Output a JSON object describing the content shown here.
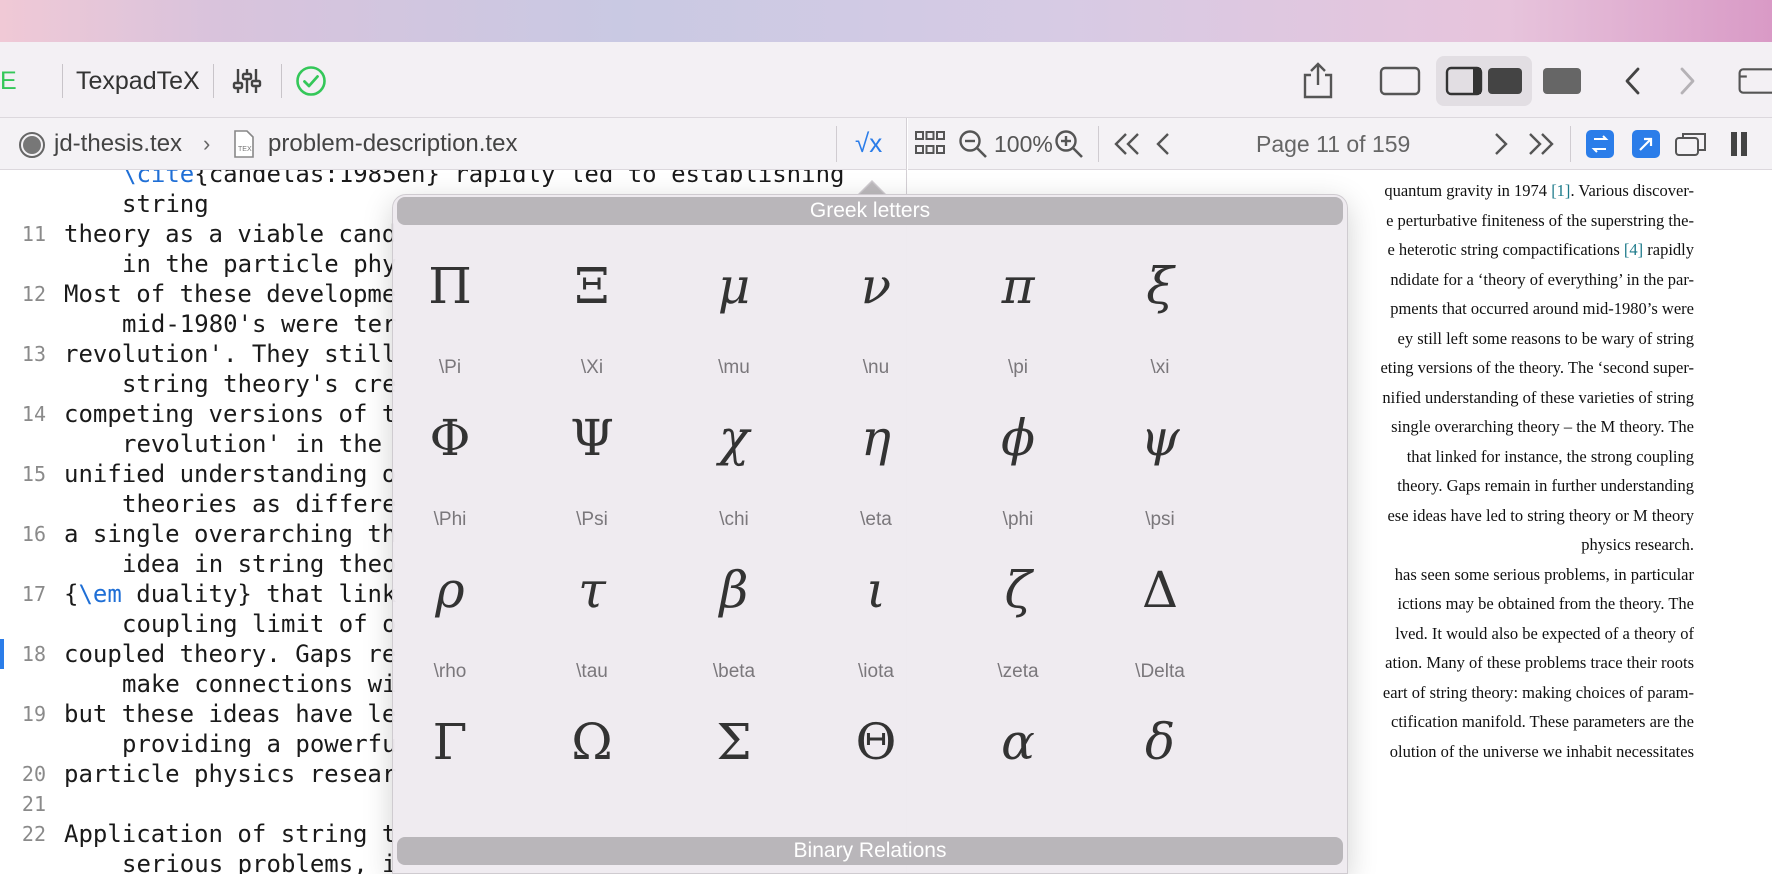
{
  "toolbar": {
    "left_fragment": "E",
    "typesetter": "TexpadTeX"
  },
  "pathbar": {
    "project_file": "jd-thesis.tex",
    "current_file": "problem-description.tex",
    "math_symbol": "√x"
  },
  "viewer": {
    "zoom": "100%",
    "page_info": "Page 11 of 159"
  },
  "editor": {
    "lines": [
      {
        "num": "",
        "cont": true,
        "parts": [
          {
            "kw": "\\cite"
          },
          {
            "t": "{candelas:1985en} rapidly led to establishing"
          }
        ]
      },
      {
        "num": "",
        "cont": true,
        "parts": [
          {
            "t": "string"
          }
        ]
      },
      {
        "num": "11",
        "cont": false,
        "parts": [
          {
            "t": "theory as a viable cand"
          }
        ]
      },
      {
        "num": "",
        "cont": true,
        "parts": [
          {
            "t": "in the particle phy"
          }
        ]
      },
      {
        "num": "12",
        "cont": false,
        "parts": [
          {
            "t": "Most of these developme"
          }
        ]
      },
      {
        "num": "",
        "cont": true,
        "parts": [
          {
            "t": "mid-1980's were ter"
          }
        ]
      },
      {
        "num": "13",
        "cont": false,
        "parts": [
          {
            "t": "revolution'. They still"
          }
        ]
      },
      {
        "num": "",
        "cont": true,
        "parts": [
          {
            "t": "string theory's cre"
          }
        ]
      },
      {
        "num": "14",
        "cont": false,
        "parts": [
          {
            "t": "competing versions of t"
          }
        ]
      },
      {
        "num": "",
        "cont": true,
        "parts": [
          {
            "t": "revolution' in the"
          }
        ]
      },
      {
        "num": "15",
        "cont": false,
        "parts": [
          {
            "t": "unified understanding o"
          }
        ]
      },
      {
        "num": "",
        "cont": true,
        "parts": [
          {
            "t": "theories as differe"
          }
        ]
      },
      {
        "num": "16",
        "cont": false,
        "parts": [
          {
            "t": "a single overarching th"
          }
        ]
      },
      {
        "num": "",
        "cont": true,
        "parts": [
          {
            "t": "idea in string theo"
          }
        ]
      },
      {
        "num": "17",
        "cont": false,
        "parts": [
          {
            "t": "{"
          },
          {
            "kw": "\\em"
          },
          {
            "t": " duality} that link"
          }
        ]
      },
      {
        "num": "",
        "cont": true,
        "parts": [
          {
            "t": "coupling limit of o"
          }
        ]
      },
      {
        "num": "18",
        "cont": false,
        "current": true,
        "parts": [
          {
            "t": "coupled theory. Gaps re"
          }
        ]
      },
      {
        "num": "",
        "cont": true,
        "parts": [
          {
            "t": "make connections wi"
          }
        ]
      },
      {
        "num": "19",
        "cont": false,
        "parts": [
          {
            "t": "but these ideas have le"
          }
        ]
      },
      {
        "num": "",
        "cont": true,
        "parts": [
          {
            "t": "providing a powerfu"
          }
        ]
      },
      {
        "num": "20",
        "cont": false,
        "parts": [
          {
            "t": "particle physics resear"
          }
        ]
      },
      {
        "num": "21",
        "cont": false,
        "parts": [
          {
            "t": ""
          }
        ]
      },
      {
        "num": "22",
        "cont": false,
        "parts": [
          {
            "t": "Application of string t"
          }
        ]
      },
      {
        "num": "",
        "cont": true,
        "parts": [
          {
            "t": "serious problems, i"
          }
        ]
      }
    ]
  },
  "pdf": {
    "lines": [
      {
        "parts": [
          {
            "t": "quantum gravity in 1974 "
          },
          {
            "c": "[1]"
          },
          {
            "t": ". Various discover-"
          }
        ]
      },
      {
        "parts": [
          {
            "t": "e perturbative finiteness of the superstring the-"
          }
        ]
      },
      {
        "parts": [
          {
            "t": "e heterotic string compactifications "
          },
          {
            "c": "[4]"
          },
          {
            "t": " rapidly"
          }
        ]
      },
      {
        "parts": [
          {
            "t": "ndidate for a ‘theory of everything’ in the par-"
          }
        ]
      },
      {
        "parts": [
          {
            "t": "pments that occurred around mid-1980’s were"
          }
        ]
      },
      {
        "parts": [
          {
            "t": "ey still left some reasons to be wary of string"
          }
        ]
      },
      {
        "parts": [
          {
            "t": "eting versions of the theory. The ‘second super-"
          }
        ]
      },
      {
        "parts": [
          {
            "t": "nified understanding of these varieties of string"
          }
        ]
      },
      {
        "parts": [
          {
            "t": "single overarching theory – the M theory.  The"
          }
        ]
      },
      {
        "parts": [
          {
            "t": "that linked for instance, the strong coupling"
          }
        ]
      },
      {
        "parts": [
          {
            "t": "theory. Gaps remain in further understanding"
          }
        ]
      },
      {
        "parts": [
          {
            "t": "ese ideas have led to string theory or M theory"
          }
        ]
      },
      {
        "parts": [
          {
            "t": "physics research."
          }
        ]
      },
      {
        "parts": [
          {
            "t": "has seen some serious problems, in particular"
          }
        ]
      },
      {
        "parts": [
          {
            "t": "ictions may be obtained from the theory.  The"
          }
        ]
      },
      {
        "parts": [
          {
            "t": "lved.  It would also be expected of a theory of"
          }
        ]
      },
      {
        "parts": [
          {
            "t": "ation. Many of these problems trace their roots"
          }
        ]
      },
      {
        "parts": [
          {
            "t": "eart of string theory: making choices of param-"
          }
        ]
      },
      {
        "parts": [
          {
            "t": "ctification manifold.  These parameters are the"
          }
        ]
      },
      {
        "parts": [
          {
            "t": "olution of the universe we inhabit necessitates"
          }
        ]
      }
    ]
  },
  "symbols_popover": {
    "section_title": "Greek letters",
    "next_section_title": "Binary Relations",
    "symbols": [
      {
        "glyph": "Π",
        "cmd": "\\Pi",
        "italic": false
      },
      {
        "glyph": "Ξ",
        "cmd": "\\Xi",
        "italic": false
      },
      {
        "glyph": "μ",
        "cmd": "\\mu",
        "italic": true
      },
      {
        "glyph": "ν",
        "cmd": "\\nu",
        "italic": true
      },
      {
        "glyph": "π",
        "cmd": "\\pi",
        "italic": true
      },
      {
        "glyph": "ξ",
        "cmd": "\\xi",
        "italic": true
      },
      {
        "glyph": "Φ",
        "cmd": "\\Phi",
        "italic": false
      },
      {
        "glyph": "Ψ",
        "cmd": "\\Psi",
        "italic": false
      },
      {
        "glyph": "χ",
        "cmd": "\\chi",
        "italic": true
      },
      {
        "glyph": "η",
        "cmd": "\\eta",
        "italic": true
      },
      {
        "glyph": "ϕ",
        "cmd": "\\phi",
        "italic": true
      },
      {
        "glyph": "ψ",
        "cmd": "\\psi",
        "italic": true
      },
      {
        "glyph": "ρ",
        "cmd": "\\rho",
        "italic": true
      },
      {
        "glyph": "τ",
        "cmd": "\\tau",
        "italic": true
      },
      {
        "glyph": "β",
        "cmd": "\\beta",
        "italic": true
      },
      {
        "glyph": "ι",
        "cmd": "\\iota",
        "italic": true
      },
      {
        "glyph": "ζ",
        "cmd": "\\zeta",
        "italic": true
      },
      {
        "glyph": "Δ",
        "cmd": "\\Delta",
        "italic": false
      },
      {
        "glyph": "Γ",
        "cmd": "",
        "italic": false
      },
      {
        "glyph": "Ω",
        "cmd": "",
        "italic": false
      },
      {
        "glyph": "Σ",
        "cmd": "",
        "italic": false
      },
      {
        "glyph": "Θ",
        "cmd": "",
        "italic": false
      },
      {
        "glyph": "α",
        "cmd": "",
        "italic": true
      },
      {
        "glyph": "δ",
        "cmd": "",
        "italic": true
      }
    ]
  },
  "colors": {
    "accent": "#2b7de9",
    "ok_green": "#34c759",
    "keyword": "#1f6fd6"
  }
}
